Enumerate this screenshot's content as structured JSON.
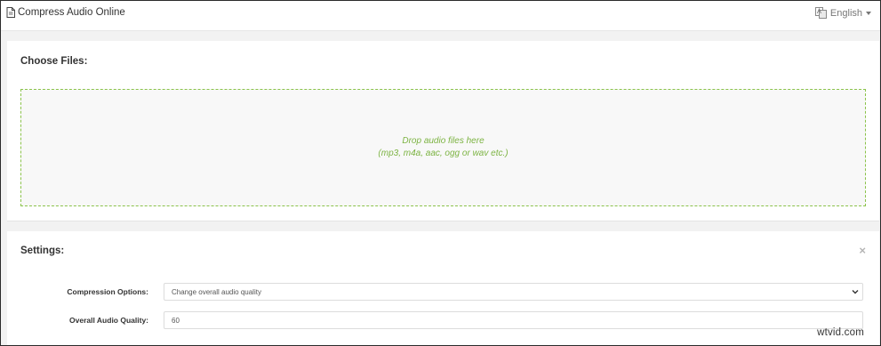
{
  "navbar": {
    "brand_label": "Compress Audio Online",
    "brand_icon": "document-icon",
    "language_label": "English",
    "language_icon": "translate-icon"
  },
  "files_panel": {
    "title": "Choose Files:",
    "dropzone_line1": "Drop audio files here",
    "dropzone_line2": "(mp3, m4a, aac, ogg or wav etc.)"
  },
  "settings_panel": {
    "title": "Settings:",
    "close_symbol": "×",
    "compression_options": {
      "label": "Compression Options:",
      "selected": "Change overall audio quality"
    },
    "overall_quality": {
      "label": "Overall Audio Quality:",
      "value": "60"
    }
  },
  "watermark": "wtvid.com",
  "colors": {
    "accent_green": "#7cb342",
    "page_background": "#f2f2f2"
  }
}
